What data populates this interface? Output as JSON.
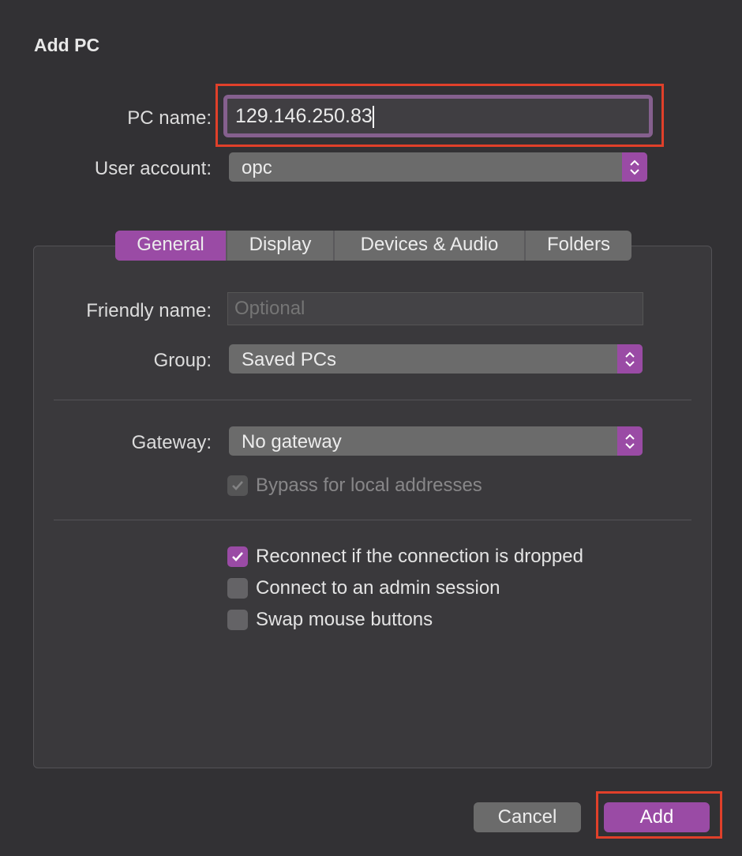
{
  "dialog": {
    "title": "Add PC"
  },
  "pc_name": {
    "label": "PC name:",
    "value": "129.146.250.83"
  },
  "user_account": {
    "label": "User account:",
    "value": "opc"
  },
  "tabs": [
    {
      "label": "General"
    },
    {
      "label": "Display"
    },
    {
      "label": "Devices & Audio"
    },
    {
      "label": "Folders"
    }
  ],
  "general": {
    "friendly_name": {
      "label": "Friendly name:",
      "placeholder": "Optional"
    },
    "group": {
      "label": "Group:",
      "value": "Saved PCs"
    },
    "gateway": {
      "label": "Gateway:",
      "value": "No gateway"
    },
    "bypass": {
      "label": "Bypass for local addresses",
      "checked": true,
      "disabled": true
    },
    "reconnect": {
      "label": "Reconnect if the connection is dropped",
      "checked": true
    },
    "admin": {
      "label": "Connect to an admin session",
      "checked": false
    },
    "swap": {
      "label": "Swap mouse buttons",
      "checked": false
    }
  },
  "buttons": {
    "cancel": "Cancel",
    "add": "Add"
  },
  "colors": {
    "accent": "#9a4ba5",
    "highlight": "#e0402a"
  }
}
